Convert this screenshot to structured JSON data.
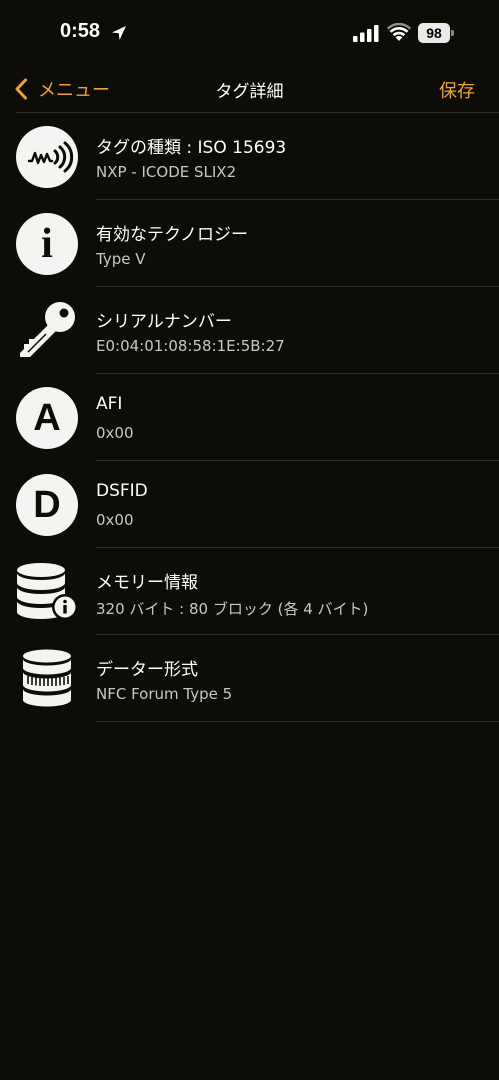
{
  "status_bar": {
    "time": "0:58",
    "battery": "98"
  },
  "nav": {
    "back_label": "メニュー",
    "title": "タグ詳細",
    "save_label": "保存"
  },
  "rows": [
    {
      "title": "タグの種類 : ISO 15693",
      "subtitle": "NXP - ICODE SLIX2",
      "icon": "nfc-wave-icon"
    },
    {
      "title": "有効なテクノロジー",
      "subtitle": "Type V",
      "icon": "info-icon",
      "icon_text": "i"
    },
    {
      "title": "シリアルナンバー",
      "subtitle": "E0:04:01:08:58:1E:5B:27",
      "icon": "key-icon"
    },
    {
      "title": "AFI",
      "subtitle": "0x00",
      "icon": "letter-a-icon",
      "icon_text": "A"
    },
    {
      "title": "DSFID",
      "subtitle": "0x00",
      "icon": "letter-d-icon",
      "icon_text": "D"
    },
    {
      "title": "メモリー情報",
      "subtitle": "320 バイト : 80 ブロック (各 4 バイト)",
      "icon": "database-info-icon"
    },
    {
      "title": "データー形式",
      "subtitle": "NFC Forum Type 5",
      "icon": "database-format-icon"
    }
  ],
  "colors": {
    "background": "#0d0c07",
    "accent": "#f0a23a",
    "divider": "#2c2b25",
    "icon_fill": "#f4f4f2"
  }
}
